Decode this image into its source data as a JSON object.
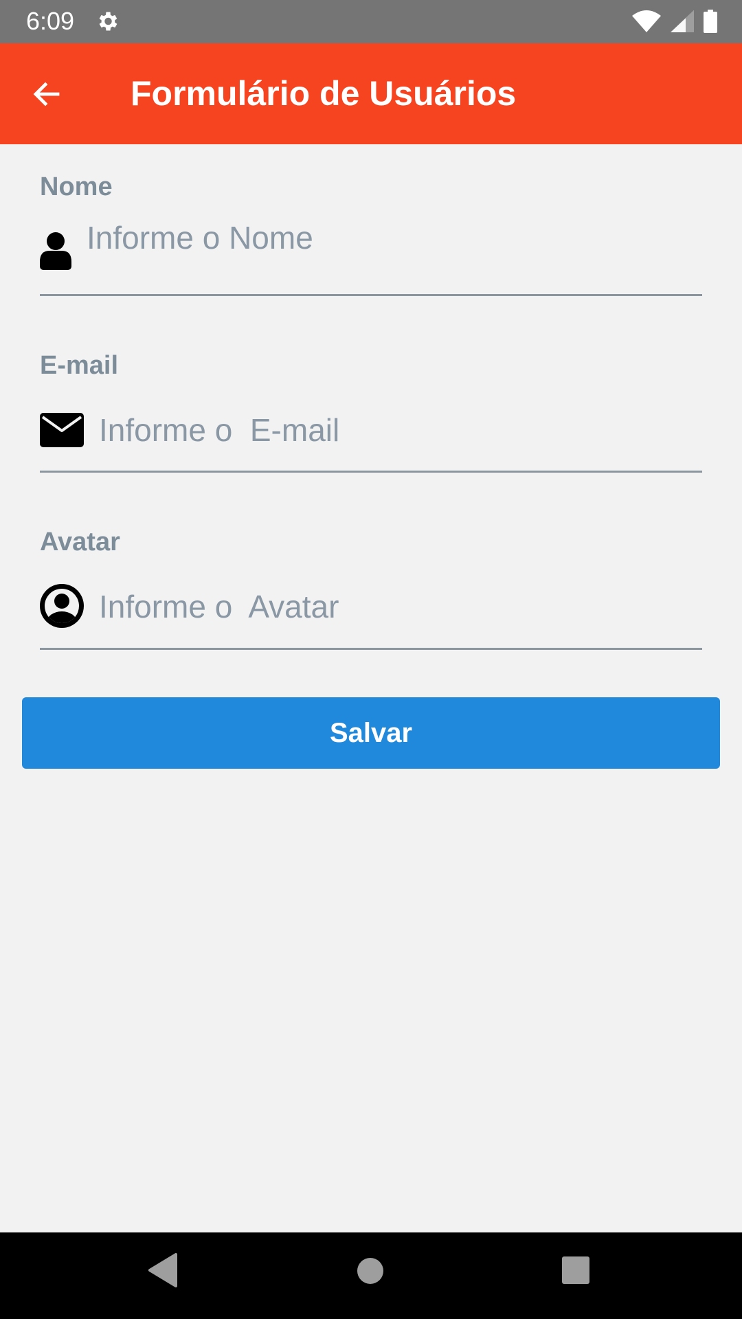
{
  "status_bar": {
    "time": "6:09"
  },
  "app_bar": {
    "title": "Formulário de Usuários"
  },
  "form": {
    "name": {
      "label": "Nome",
      "placeholder": "Informe o Nome",
      "value": ""
    },
    "email": {
      "label": "E-mail",
      "placeholder": "Informe o  E-mail",
      "value": ""
    },
    "avatar": {
      "label": "Avatar",
      "placeholder": "Informe o  Avatar",
      "value": ""
    }
  },
  "save_button": {
    "label": "Salvar"
  },
  "colors": {
    "app_bar": "#f64420",
    "button": "#2089dc",
    "label": "#7d8c99",
    "background": "#f2f2f2"
  },
  "icons": {
    "back": "arrow-left-icon",
    "name": "user-icon",
    "email": "envelope-icon",
    "avatar": "user-circle-icon"
  }
}
